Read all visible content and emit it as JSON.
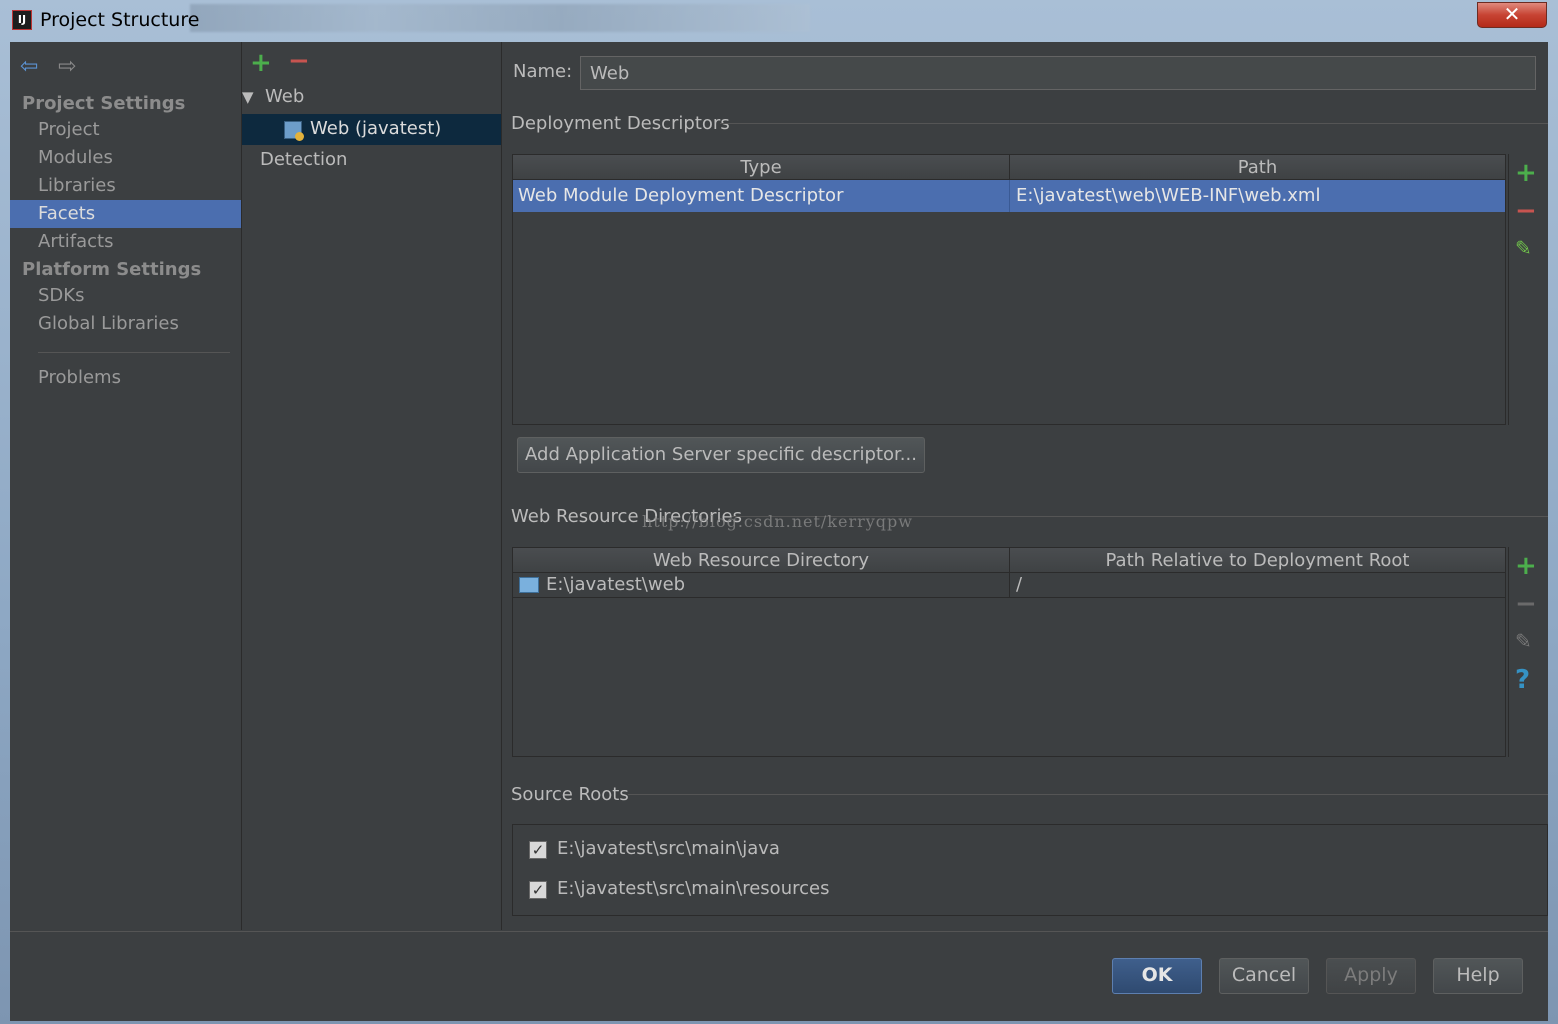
{
  "window": {
    "title": "Project Structure",
    "close_glyph": "✕",
    "app_icon_text": "IJ"
  },
  "nav": {
    "back_glyph": "⇦",
    "forward_glyph": "⇨"
  },
  "sidebar": {
    "project_settings_header": "Project Settings",
    "project_items": [
      {
        "label": "Project"
      },
      {
        "label": "Modules"
      },
      {
        "label": "Libraries"
      },
      {
        "label": "Facets"
      },
      {
        "label": "Artifacts"
      }
    ],
    "platform_settings_header": "Platform Settings",
    "platform_items": [
      {
        "label": "SDKs"
      },
      {
        "label": "Global Libraries"
      }
    ],
    "problems_label": "Problems",
    "selected": "Facets"
  },
  "tree": {
    "add_glyph": "+",
    "remove_glyph": "−",
    "expand_glyph": "▼",
    "root_label": "Web",
    "child_label": "Web (javatest)",
    "detection_label": "Detection"
  },
  "facet": {
    "name_label": "Name:",
    "name_value": "Web",
    "deployment_section": "Deployment Descriptors",
    "deployment_table": {
      "headers": [
        "Type",
        "Path"
      ],
      "rows": [
        {
          "type": "Web Module Deployment Descriptor",
          "path": "E:\\javatest\\web\\WEB-INF\\web.xml"
        }
      ]
    },
    "add_server_descriptor_button": "Add Application Server specific descriptor...",
    "web_resource_section": "Web Resource Directories",
    "web_resource_table": {
      "headers": [
        "Web Resource Directory",
        "Path Relative to Deployment Root"
      ],
      "rows": [
        {
          "dir": "E:\\javatest\\web",
          "path": "/"
        }
      ]
    },
    "source_roots_section": "Source Roots",
    "source_roots": [
      {
        "path": "E:\\javatest\\src\\main\\java",
        "checked": true
      },
      {
        "path": "E:\\javatest\\src\\main\\resources",
        "checked": true
      }
    ],
    "check_glyph": "✓",
    "help_glyph": "?",
    "edit_glyph": "✎"
  },
  "watermark": "http://blog.csdn.net/kerryqpw",
  "footer": {
    "ok": "OK",
    "cancel": "Cancel",
    "apply": "Apply",
    "help": "Help"
  },
  "colors": {
    "selection": "#4b6eaf",
    "tree_selection": "#0d293e",
    "panel": "#3c3f41",
    "add": "#4cae4c",
    "remove": "#c75450",
    "text": "#bbbbbb"
  }
}
